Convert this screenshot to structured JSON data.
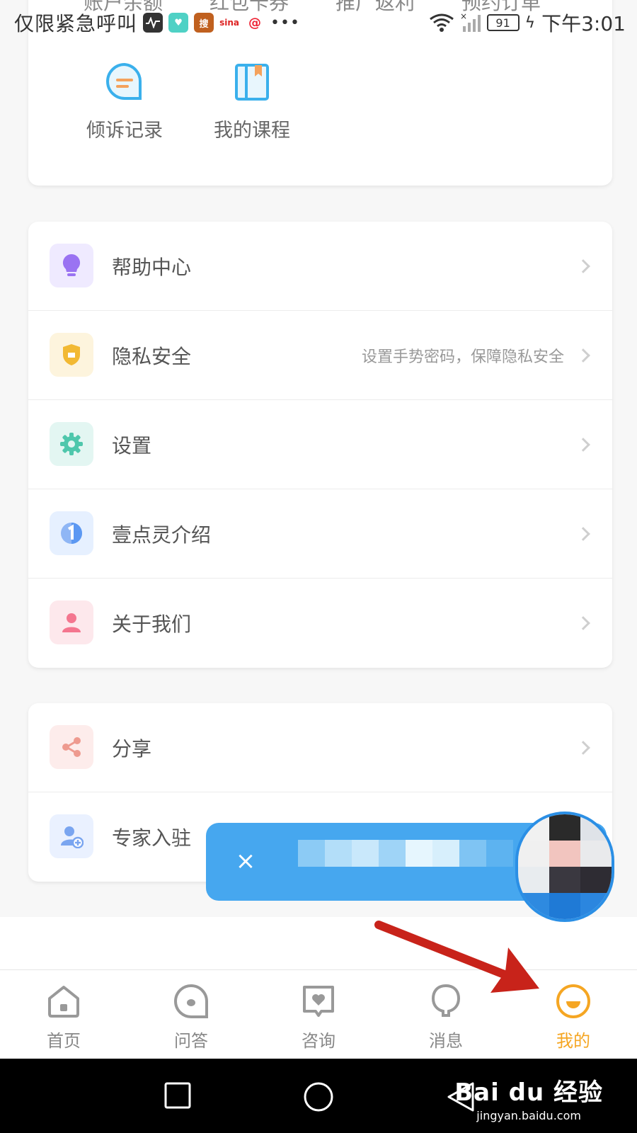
{
  "status_bar": {
    "carrier_text": "仅限紧急呼叫",
    "battery": "91",
    "time": "下午3:01",
    "cut_off_labels": [
      "账户余额",
      "红包卡券",
      "推广返利",
      "预约订单"
    ]
  },
  "quick_actions": [
    {
      "label": "倾诉记录",
      "icon": "chat-bubble-icon"
    },
    {
      "label": "我的课程",
      "icon": "book-icon"
    }
  ],
  "menu_group_1": [
    {
      "label": "帮助中心",
      "hint": "",
      "icon": "lightbulb-icon",
      "icon_bg": "#efeaff",
      "icon_color": "#9a73f2"
    },
    {
      "label": "隐私安全",
      "hint": "设置手势密码，保障隐私安全",
      "icon": "shield-icon",
      "icon_bg": "#fdf4dd",
      "icon_color": "#f2b933"
    },
    {
      "label": "设置",
      "hint": "",
      "icon": "gear-icon",
      "icon_bg": "#e3f6f2",
      "icon_color": "#4fc7ac"
    },
    {
      "label": "壹点灵介绍",
      "hint": "",
      "icon": "info-one-icon",
      "icon_bg": "#e6f0ff",
      "icon_color": "#5c98f2"
    },
    {
      "label": "关于我们",
      "hint": "",
      "icon": "person-icon",
      "icon_bg": "#fde8ec",
      "icon_color": "#f4768f"
    }
  ],
  "menu_group_2": [
    {
      "label": "分享",
      "icon": "share-icon",
      "icon_bg": "#fdeceb",
      "icon_color": "#ee9a8f"
    },
    {
      "label": "专家入驻",
      "icon": "add-user-icon",
      "icon_bg": "#eaf1ff",
      "icon_color": "#7aa5f0"
    }
  ],
  "floating_banner": {
    "close_symbol": "×"
  },
  "tabs": [
    {
      "label": "首页",
      "icon": "home-icon",
      "active": false
    },
    {
      "label": "问答",
      "icon": "qa-bubble-icon",
      "active": false
    },
    {
      "label": "咨询",
      "icon": "heart-chat-icon",
      "active": false
    },
    {
      "label": "消息",
      "icon": "bell-bubble-icon",
      "active": false
    },
    {
      "label": "我的",
      "icon": "me-smile-icon",
      "active": true
    }
  ],
  "watermark": {
    "brand": "Bai du 经验",
    "url": "jingyan.baidu.com"
  },
  "colors": {
    "accent_active": "#f5a623",
    "banner_blue": "#46a7ef",
    "arrow_red": "#c8231a"
  }
}
